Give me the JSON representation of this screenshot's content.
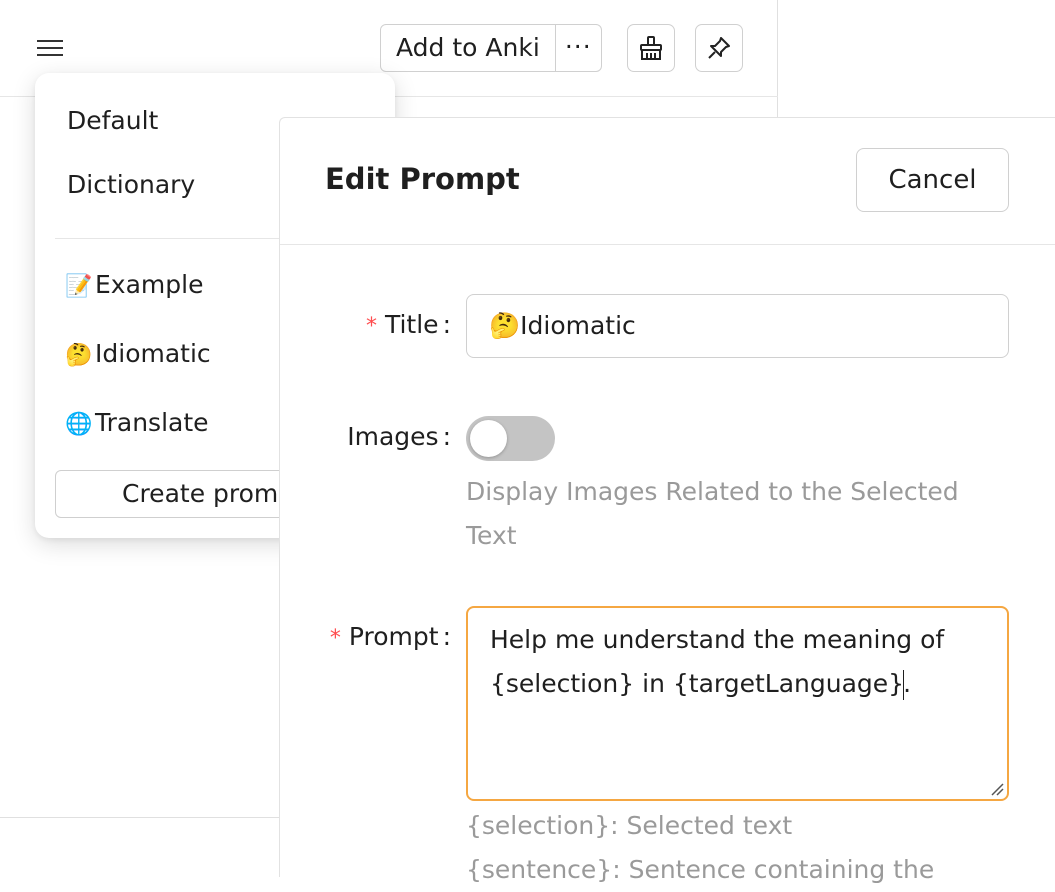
{
  "toolbar": {
    "add_to_anki_label": "Add to Anki",
    "more_label": "···",
    "icons": [
      "menu-icon",
      "broom-icon",
      "pin-icon"
    ]
  },
  "prompt_menu": {
    "items": [
      {
        "label": "Default"
      },
      {
        "label": "Dictionary"
      }
    ],
    "custom_items": [
      {
        "emoji": "📝",
        "label": "Example"
      },
      {
        "emoji": "🤔",
        "label": "Idiomatic"
      },
      {
        "emoji": "🌐",
        "label": "Translate"
      }
    ],
    "create_label": "Create prompt"
  },
  "edit_prompt": {
    "title": "Edit Prompt",
    "cancel_label": "Cancel",
    "fields": {
      "title_label": "Title",
      "title_value": "🤔Idiomatic",
      "images_label": "Images",
      "images_enabled": false,
      "images_help": "Display Images Related to the Selected Text",
      "prompt_label": "Prompt",
      "prompt_value_before_caret": "Help me understand the meaning of {selection} in {targetLanguage}",
      "prompt_value_after_caret": ".",
      "variables": [
        "{selection}: Selected text",
        "{sentence}: Sentence containing the"
      ]
    },
    "colors": {
      "required_mark": "#ff4d4f",
      "focus_border": "#f5a742",
      "help_text": "#9a9a9a"
    }
  }
}
